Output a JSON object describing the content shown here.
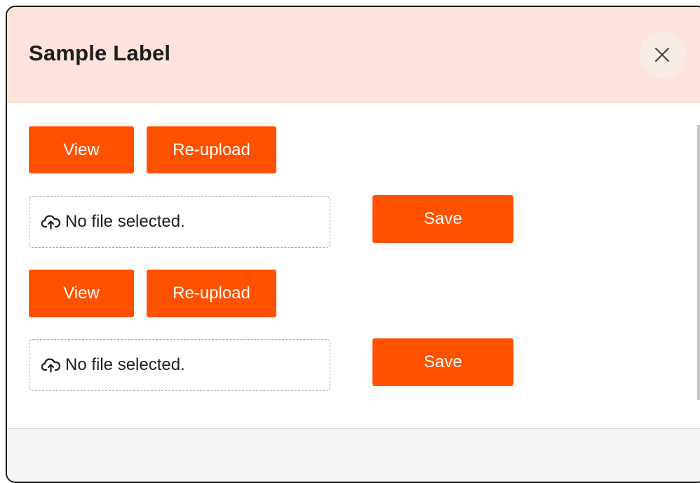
{
  "modal": {
    "title": "Sample Label",
    "close_icon": "close-icon"
  },
  "rows": [
    {
      "view_label": "View",
      "reupload_label": "Re-upload",
      "file_status": "No file selected.",
      "upload_icon": "cloud-upload-icon",
      "save_label": "Save"
    },
    {
      "view_label": "View",
      "reupload_label": "Re-upload",
      "file_status": "No file selected.",
      "upload_icon": "cloud-upload-icon",
      "save_label": "Save"
    }
  ],
  "colors": {
    "accent": "#ff5100",
    "header_bg": "#fde3db",
    "footer_bg": "#f4f4f4"
  }
}
